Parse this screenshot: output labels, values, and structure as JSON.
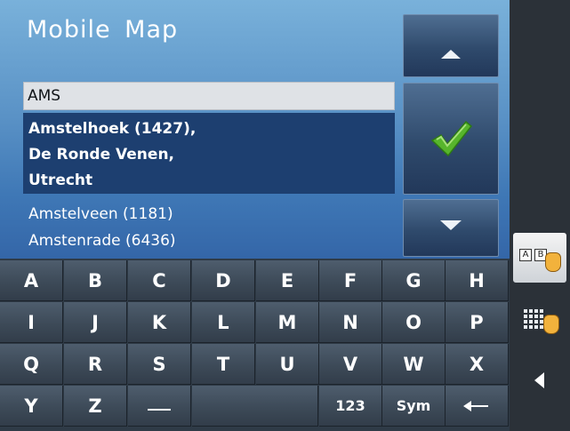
{
  "app": {
    "title": "Mobile Map"
  },
  "search": {
    "value": "AMS"
  },
  "results": {
    "selected": "Amstelhoek (1427),\nDe Ronde Venen,\nUtrecht",
    "items": [
      {
        "label": "Amstelveen (1181)"
      },
      {
        "label": "Amstenrade (6436)"
      }
    ]
  },
  "keyboard": {
    "rows": [
      [
        "A",
        "B",
        "C",
        "D",
        "E",
        "F",
        "G",
        "H"
      ],
      [
        "I",
        "J",
        "K",
        "L",
        "M",
        "N",
        "O",
        "P"
      ],
      [
        "Q",
        "R",
        "S",
        "T",
        "U",
        "V",
        "W",
        "X"
      ],
      [
        "Y",
        "Z"
      ]
    ],
    "numbers_label": "123",
    "symbols_label": "Sym"
  },
  "rail": {
    "abc_letters": [
      "A",
      "B"
    ]
  },
  "colors": {
    "panel_top": "#79b1da",
    "panel_bottom": "#3466a8",
    "selected_row": "#1d3f70",
    "check_green": "#57b52c",
    "key_face": "#3d4a58"
  },
  "icons": {
    "up": "triangle-up",
    "ok": "checkmark",
    "down": "triangle-down",
    "space": "space-bar",
    "backspace": "left-arrow",
    "keyboard_abc": "abc-keyboard-hand",
    "keyboard_grid": "grid-keyboard-hand",
    "back": "triangle-left"
  }
}
